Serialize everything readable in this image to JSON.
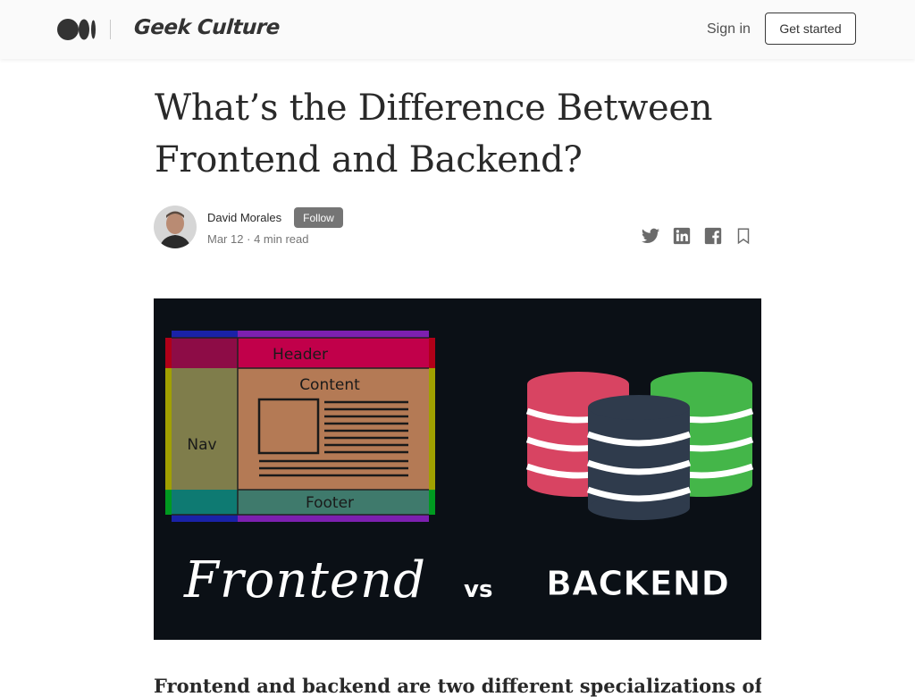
{
  "header": {
    "logo_icon": "medium-logo-icon",
    "publication": "Geek Culture",
    "sign_in": "Sign in",
    "get_started": "Get started"
  },
  "article": {
    "title": "What’s the Difference Between Frontend and Backend?",
    "author": "David Morales",
    "follow": "Follow",
    "date": "Mar 12",
    "read_time": "4 min read",
    "meta_separator": "·",
    "share_icons": [
      "twitter-icon",
      "linkedin-icon",
      "facebook-icon",
      "bookmark-icon"
    ]
  },
  "hero": {
    "layout_labels": {
      "header": "Header",
      "content": "Content",
      "nav": "Nav",
      "footer": "Footer"
    },
    "frontend_text": "Frontend",
    "vs_text": "vs",
    "backend_text": "BACKEND",
    "colors": {
      "background": "#0b1016",
      "db_red": "#d84462",
      "db_dark": "#2f3b4c",
      "db_green": "#44b649",
      "header_block": "#c1004a",
      "content_block": "#b47a55",
      "nav_block": "#7f7d4b",
      "footer_block": "#3f7a6c"
    }
  },
  "body": {
    "first_line": "Frontend and backend are two different specializations of"
  }
}
